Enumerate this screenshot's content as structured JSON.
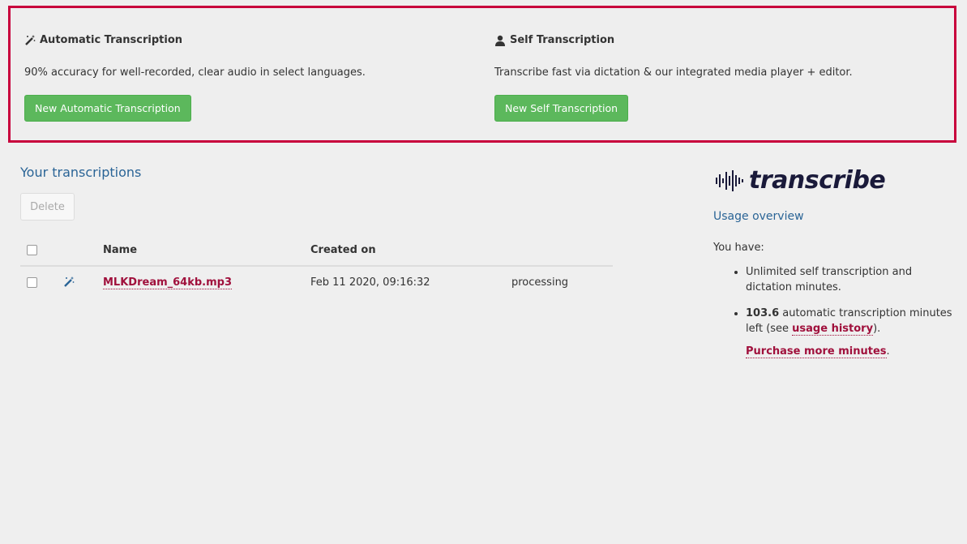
{
  "auto": {
    "title": "Automatic Transcription",
    "description": "90% accuracy for well-recorded, clear audio in select languages.",
    "button": "New Automatic Transcription",
    "icon": "magic-wand-icon"
  },
  "self": {
    "title": "Self Transcription",
    "description": "Transcribe fast via dictation & our integrated media player + editor.",
    "button": "New Self Transcription",
    "icon": "user-icon"
  },
  "transcriptions": {
    "title": "Your transcriptions",
    "delete_label": "Delete",
    "columns": {
      "name": "Name",
      "created": "Created on"
    },
    "rows": [
      {
        "name": "MLKDream_64kb.mp3",
        "created": "Feb 11 2020, 09:16:32",
        "status": "processing",
        "type_icon": "magic-wand-icon"
      }
    ]
  },
  "sidebar": {
    "logo": "transcribe",
    "usage_title": "Usage overview",
    "you_have": "You have:",
    "item1": "Unlimited self transcription and dictation minutes.",
    "minutes_value": "103.6",
    "item2_text": " automatic transcription minutes left (see ",
    "usage_history": "usage history",
    "item2_end": ").",
    "purchase": "Purchase more minutes",
    "purchase_end": "."
  },
  "colors": {
    "accent_border": "#c8003c",
    "button_green": "#5cb85c",
    "link_red": "#a0103c",
    "heading_blue": "#2a6496"
  }
}
